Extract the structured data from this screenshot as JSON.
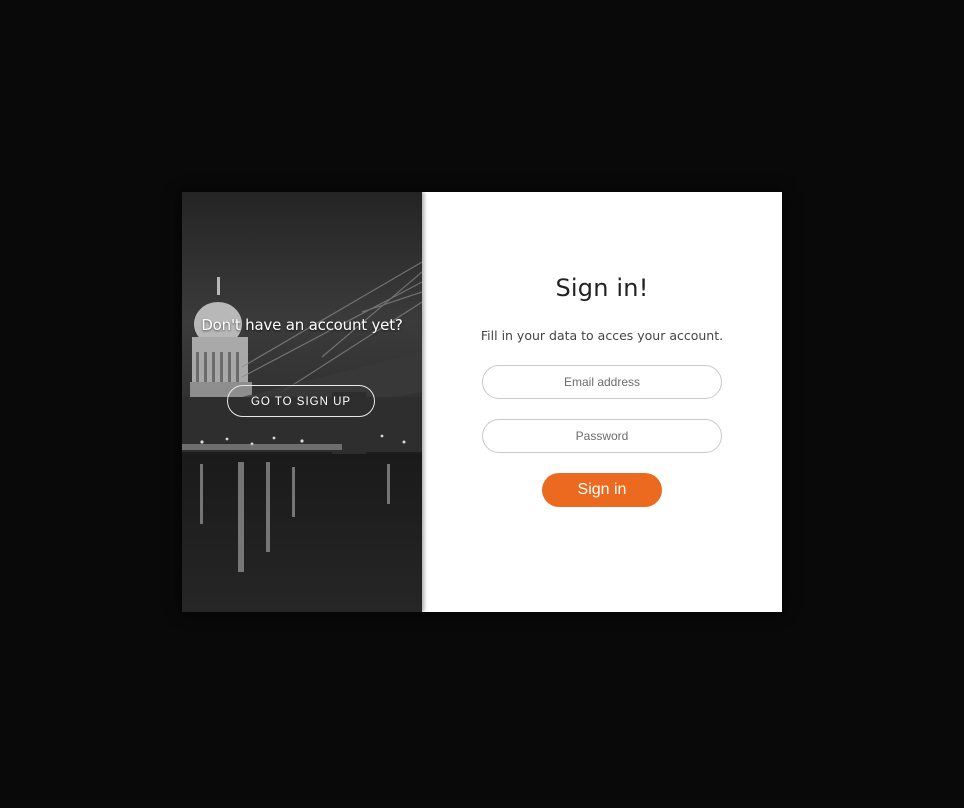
{
  "side_panel": {
    "prompt": "Don't have an account yet?",
    "signup_label": "GO TO SIGN UP"
  },
  "form": {
    "title": "Sign in!",
    "subtitle": "Fill in your data to acces your account.",
    "email_placeholder": "Email address",
    "password_placeholder": "Password",
    "submit_label": "Sign in"
  },
  "colors": {
    "backdrop": "#090909",
    "accent": "#ec6a1f",
    "panel": "#ffffff"
  }
}
